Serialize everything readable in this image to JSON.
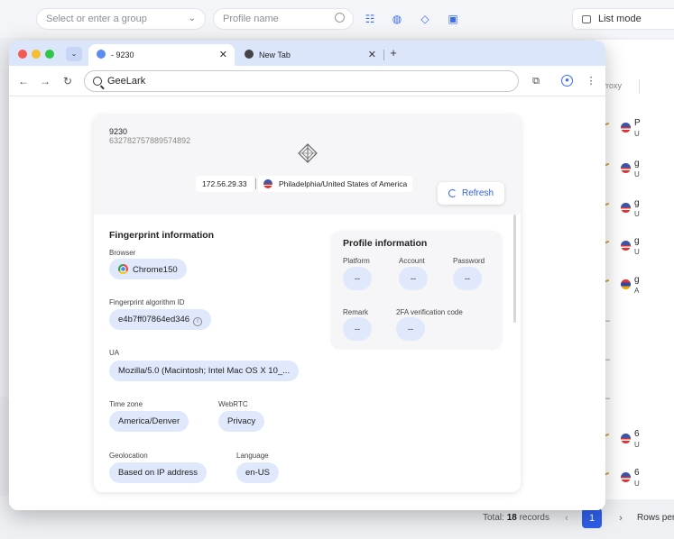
{
  "background": {
    "group_select_placeholder": "Select or enter a group",
    "profile_search_placeholder": "Profile name",
    "list_mode_label": "List mode",
    "proxy_header": "Proxy",
    "rows": [
      {
        "t1": "P",
        "t2": "U"
      },
      {
        "t1": "g",
        "t2": "U"
      },
      {
        "t1": "g",
        "t2": "U"
      },
      {
        "t1": "g",
        "t2": "U"
      },
      {
        "t1": "g",
        "t2": "A"
      },
      {
        "t1": "6",
        "t2": "U"
      },
      {
        "t1": "6",
        "t2": "U"
      }
    ],
    "dash": "–",
    "total_prefix": "Total:",
    "total_count": "18",
    "total_suffix": "records",
    "current_page": "1",
    "rows_per_label": "Rows per",
    "accent_color": "#3b6bf5"
  },
  "browser": {
    "tabs": [
      {
        "title": "- 9230",
        "close": "✕"
      },
      {
        "title": "New Tab",
        "close": "✕"
      }
    ],
    "new_tab_icon": "+",
    "address": "GeeLark"
  },
  "profile": {
    "name": "9230",
    "id": "632782757889574892",
    "ip": "172.56.29.33",
    "location": "Philadelphia/United States of America",
    "refresh_label": "Refresh"
  },
  "fingerprint": {
    "title": "Fingerprint information",
    "browser_label": "Browser",
    "browser_value": "Chrome150",
    "algo_label": "Fingerprint algorithm ID",
    "algo_value": "e4b7ff07864ed346",
    "ua_label": "UA",
    "ua_value": "Mozilla/5.0 (Macintosh; Intel Mac OS X 10_...",
    "timezone_label": "Time zone",
    "timezone_value": "America/Denver",
    "webrtc_label": "WebRTC",
    "webrtc_value": "Privacy",
    "geo_label": "Geolocation",
    "geo_value": "Based on IP address",
    "language_label": "Language",
    "language_value": "en-US"
  },
  "profile_info": {
    "title": "Profile information",
    "platform_label": "Platform",
    "platform_value": "--",
    "account_label": "Account",
    "account_value": "--",
    "password_label": "Password",
    "password_value": "--",
    "remark_label": "Remark",
    "remark_value": "--",
    "twofa_label": "2FA verification code",
    "twofa_value": "--"
  }
}
